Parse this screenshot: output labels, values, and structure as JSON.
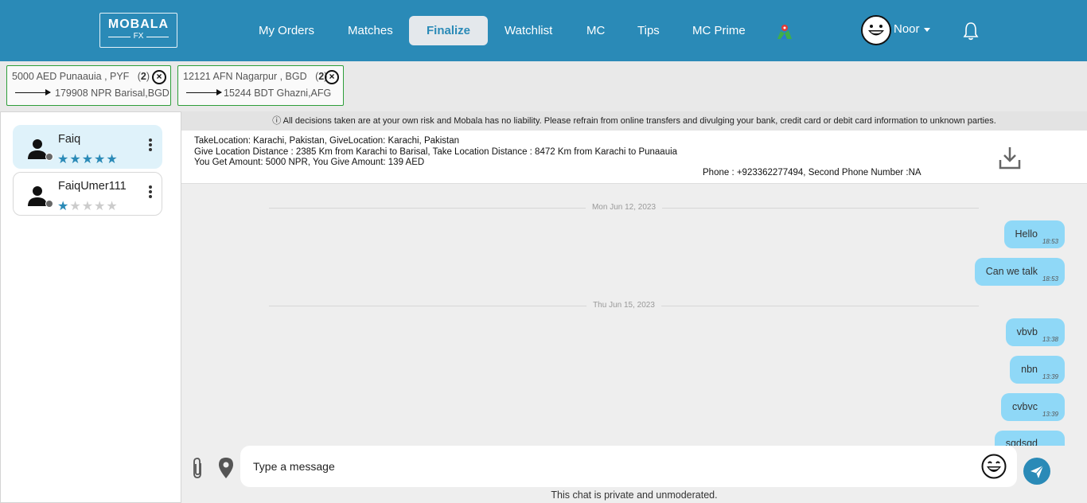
{
  "header": {
    "logo_top": "MOBALA",
    "logo_bottom": "FX",
    "nav": [
      {
        "label": "My Orders"
      },
      {
        "label": "Matches"
      },
      {
        "label": "Finalize"
      },
      {
        "label": "Watchlist"
      },
      {
        "label": "MC"
      },
      {
        "label": "Tips"
      },
      {
        "label": "MC Prime"
      }
    ],
    "active_nav": "Finalize",
    "user_name": "Noor",
    "brand_color": "#2a8ab7"
  },
  "deals": [
    {
      "give": "5000 AED Punaauia , PYF",
      "count_open": "(",
      "count": "2",
      "count_close": ")",
      "take": "179908 NPR Barisal,BGD"
    },
    {
      "give": "12121 AFN Nagarpur , BGD",
      "count_open": "(",
      "count": "2",
      "count_close": ")",
      "take": "15244 BDT Ghazni,AFG"
    }
  ],
  "contacts": [
    {
      "name": "Faiq",
      "rating": 5,
      "selected": true
    },
    {
      "name": "FaiqUmer111",
      "rating": 1,
      "selected": false
    }
  ],
  "chat": {
    "disclaimer": "ⓘ All decisions taken are at your own risk and Mobala has no liability. Please refrain from online transfers and divulging your bank, credit card or debit card information to unknown parties.",
    "info_line1": "TakeLocation: Karachi, Pakistan, GiveLocation: Karachi, Pakistan",
    "info_line2": "Give Location Distance : 2385 Km from Karachi to Barisal, Take Location Distance : 8472 Km from Karachi to Punaauia",
    "info_line3": "You Get Amount: 5000 NPR, You Give Amount: 139 AED",
    "phone": "Phone : +923362277494, Second Phone Number :NA",
    "date1": "Mon Jun 12, 2023",
    "date2": "Thu Jun 15, 2023",
    "messages": [
      {
        "text": "Hello",
        "time": "18:53"
      },
      {
        "text": "Can we talk",
        "time": "18:53"
      },
      {
        "text": "vbvb",
        "time": "13:38"
      },
      {
        "text": "nbn",
        "time": "13:39"
      },
      {
        "text": "cvbvc",
        "time": "13:39"
      },
      {
        "text": "sgdsgd",
        "time": ""
      }
    ],
    "input_placeholder": "Type a message",
    "private_note": "This chat is private and unmoderated."
  }
}
